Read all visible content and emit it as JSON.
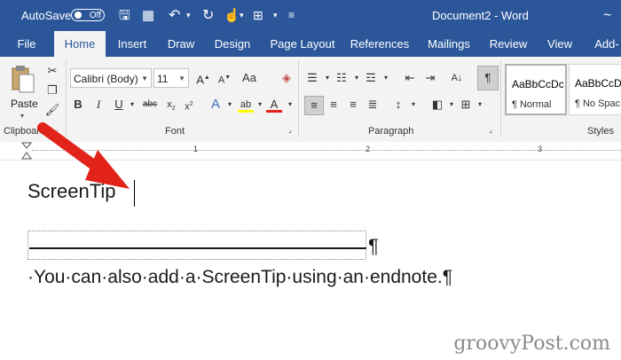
{
  "titlebar": {
    "autosave_label": "AutoSave",
    "autosave_state": "Off",
    "document_title": "Document2 - Word",
    "truncated_suffix": "~"
  },
  "tabs": [
    "File",
    "Home",
    "Insert",
    "Draw",
    "Design",
    "Page Layout",
    "References",
    "Mailings",
    "Review",
    "View",
    "Add-"
  ],
  "active_tab": "Home",
  "ribbon": {
    "clipboard": {
      "paste_label": "Paste",
      "group_label": "Clipboard"
    },
    "font": {
      "font_name": "Calibri (Body)",
      "font_size": "11",
      "group_label": "Font"
    },
    "paragraph": {
      "group_label": "Paragraph"
    },
    "styles": {
      "group_label": "Styles",
      "items": [
        {
          "sample": "AaBbCcDc",
          "name": "¶ Normal"
        },
        {
          "sample": "AaBbCcDc",
          "name": "¶ No Spac"
        }
      ]
    }
  },
  "ruler": {
    "numbers": [
      "1",
      "2",
      "3"
    ]
  },
  "document": {
    "heading_text": "ScreenTip",
    "separator_pilcrow": "¶",
    "endnote_text": "·You·can·also·add·a·ScreenTip·using·an·endnote.¶"
  },
  "watermark": "groovyPost.com",
  "colors": {
    "title_bar": "#2b579a",
    "ribbon_bg": "#f3f3f3",
    "arrow": "#e2231a"
  }
}
